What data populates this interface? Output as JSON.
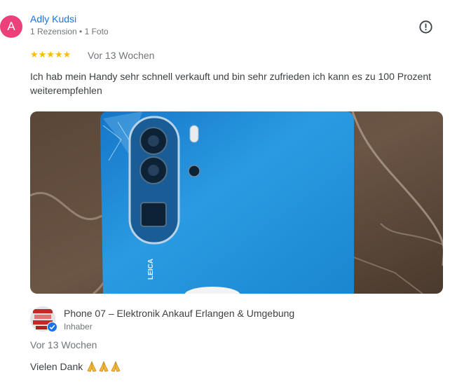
{
  "review": {
    "avatar_letter": "A",
    "avatar_color": "#ec407a",
    "reviewer_name": "Adly Kudsi",
    "reviewer_meta": "1 Rezension • 1 Foto",
    "rating": 5,
    "stars_text": "★★★★★",
    "star_color": "#fbbc04",
    "date": "Vor 13 Wochen",
    "text": "Ich hab mein Handy sehr schnell verkauft und bin sehr zufrieden ich kann es zu 100 Prozent weiterempfehlen",
    "report_icon": "report-flag-icon"
  },
  "owner_reply": {
    "owner_name": "Phone 07 – Elektronik Ankauf Erlangen & Umgebung",
    "owner_role": "Inhaber",
    "date": "Vor 13 Wochen",
    "text": "Vielen Dank",
    "emoji_icon": "folded-hands-icon"
  },
  "colors": {
    "link_blue": "#1a73e8",
    "secondary_text": "#70757a",
    "phone_blue": "#1f8fd6"
  }
}
